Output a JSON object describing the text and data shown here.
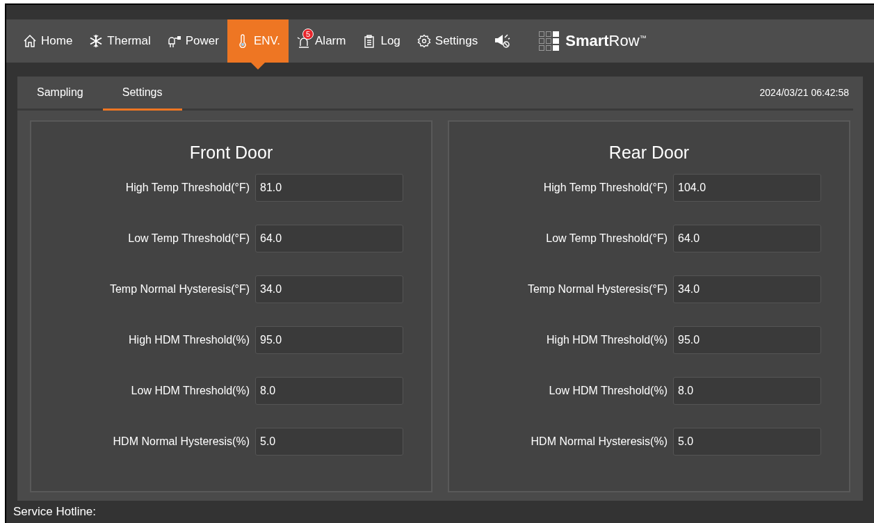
{
  "nav": [
    {
      "kind": "home",
      "label": "Home",
      "selected": false
    },
    {
      "kind": "thermal",
      "label": "Thermal",
      "selected": false
    },
    {
      "kind": "power",
      "label": "Power",
      "selected": false
    },
    {
      "kind": "env",
      "label": "ENV.",
      "selected": true
    },
    {
      "kind": "alarm",
      "label": "Alarm",
      "selected": false,
      "badge": "5"
    },
    {
      "kind": "log",
      "label": "Log",
      "selected": false
    },
    {
      "kind": "settings",
      "label": "Settings",
      "selected": false
    },
    {
      "kind": "mute",
      "selected": false
    }
  ],
  "logo": "**Smart**Row$^{™}$",
  "subtabs": [
    {
      "label": "Sampling",
      "selected": false
    },
    {
      "label": "Settings",
      "selected": true
    }
  ],
  "timestamp": "2024/03/21 06:42:58",
  "panels": [
    {
      "title": "Front Door",
      "fields": [
        {
          "label": "High Temp Threshold(°F)",
          "value": "81.0"
        },
        {
          "label": "Low Temp Threshold(°F)",
          "value": "64.0"
        },
        {
          "label": "Temp Normal Hysteresis(°F)",
          "value": "34.0"
        },
        {
          "label": "High HDM Threshold(%)",
          "value": "95.0"
        },
        {
          "label": "Low HDM Threshold(%)",
          "value": "8.0"
        },
        {
          "label": "HDM Normal Hysteresis(%)",
          "value": "5.0"
        }
      ]
    },
    {
      "title": "Rear Door",
      "fields": [
        {
          "label": "High Temp Threshold(°F)",
          "value": "104.0"
        },
        {
          "label": "Low Temp Threshold(°F)",
          "value": "64.0"
        },
        {
          "label": "Temp Normal Hysteresis(°F)",
          "value": "34.0"
        },
        {
          "label": "High HDM Threshold(%)",
          "value": "95.0"
        },
        {
          "label": "Low HDM Threshold(%)",
          "value": "8.0"
        },
        {
          "label": "HDM Normal Hysteresis(%)",
          "value": "5.0"
        }
      ]
    }
  ],
  "footer": "Service Hotline:"
}
